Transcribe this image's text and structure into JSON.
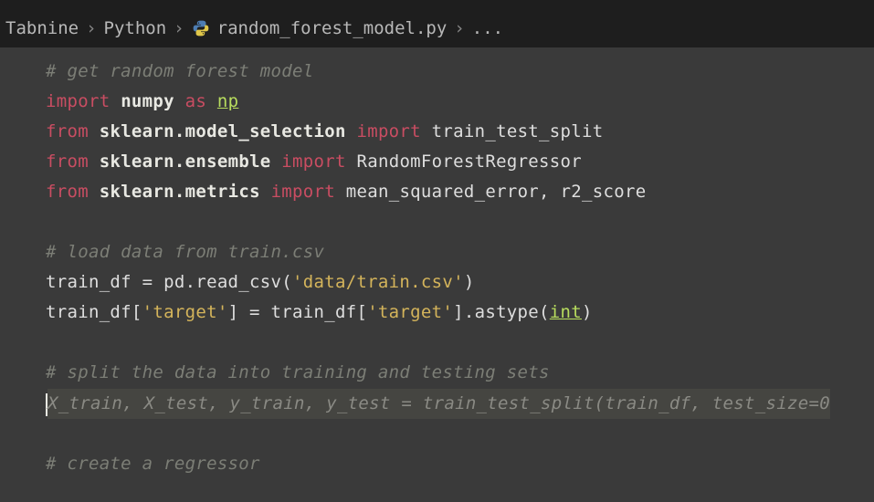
{
  "breadcrumb": {
    "items": [
      "Tabnine",
      "Python",
      "random_forest_model.py",
      "..."
    ]
  },
  "code": {
    "l1_comment": "# get random forest model",
    "l2_import": "import",
    "l2_numpy": "numpy",
    "l2_as": "as",
    "l2_np": "np",
    "l3_from": "from",
    "l3_mod": "sklearn.model_selection",
    "l3_import": "import",
    "l3_target": "train_test_split",
    "l4_from": "from",
    "l4_mod": "sklearn.ensemble",
    "l4_import": "import",
    "l4_target": "RandomForestRegressor",
    "l5_from": "from",
    "l5_mod": "sklearn.metrics",
    "l5_import": "import",
    "l5_target": "mean_squared_error, r2_score",
    "l7_comment": "# load data from train.csv",
    "l8_a": "train_df = pd.read_csv(",
    "l8_str": "'data/train.csv'",
    "l8_b": ")",
    "l9_a": "train_df[",
    "l9_str1": "'target'",
    "l9_b": "] = train_df[",
    "l9_str2": "'target'",
    "l9_c": "].astype(",
    "l9_int": "int",
    "l9_d": ")",
    "l11_comment": "# split the data into training and testing sets",
    "l12_ghost": "X_train, X_test, y_train, y_test = train_test_split(train_df, test_size=0",
    "l14_comment": "# create a regressor"
  }
}
